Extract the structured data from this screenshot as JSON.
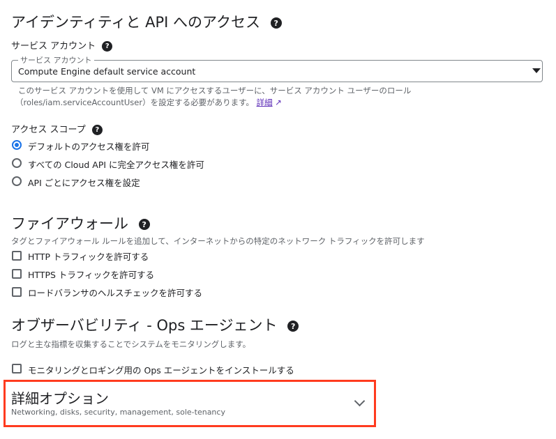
{
  "identity": {
    "title": "アイデンティティと API へのアクセス",
    "service_account_heading": "サービス アカウント",
    "select": {
      "floating_label": "サービス アカウント",
      "value": "Compute Engine default service account"
    },
    "hint_line1": "このサービス アカウントを使用して VM にアクセスするユーザーに、サービス アカウント ユーザーのロール",
    "hint_line2": "（roles/iam.serviceAccountUser）を設定する必要があります。",
    "learn_more": "詳細",
    "access_scope_heading": "アクセス スコープ",
    "scopes": [
      {
        "label": "デフォルトのアクセス権を許可",
        "selected": true
      },
      {
        "label": "すべての Cloud API に完全アクセス権を許可",
        "selected": false
      },
      {
        "label": "API ごとにアクセス権を設定",
        "selected": false
      }
    ]
  },
  "firewall": {
    "title": "ファイアウォール",
    "description": "タグとファイアウォール ルールを追加して、インターネットからの特定のネットワーク トラフィックを許可します",
    "options": [
      {
        "label": "HTTP トラフィックを許可する",
        "checked": false
      },
      {
        "label": "HTTPS トラフィックを許可する",
        "checked": false
      },
      {
        "label": "ロードバランサのヘルスチェックを許可する",
        "checked": false
      }
    ]
  },
  "observability": {
    "title": "オブザーバビリティ - Ops エージェント",
    "description": "ログと主な指標を収集することでシステムをモニタリングします。",
    "install_label": "モニタリングとロギング用の Ops エージェントをインストールする",
    "install_checked": false
  },
  "advanced": {
    "title": "詳細オプション",
    "subtitle": "Networking, disks, security, management, sole-tenancy"
  },
  "colors": {
    "highlight": "#ff3b1f",
    "accent": "#1a73e8"
  }
}
